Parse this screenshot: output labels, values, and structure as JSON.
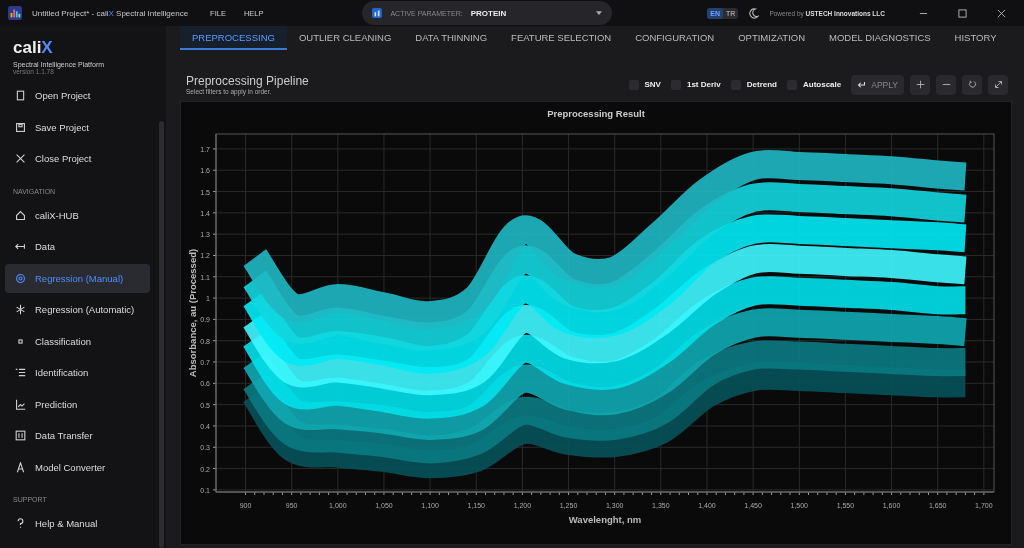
{
  "window": {
    "title": [
      {
        "text": "Untitled Project* - cali",
        "accent": false
      },
      {
        "text": "X",
        "accent": true
      },
      {
        "text": " Spectral Intelligence",
        "accent": false
      }
    ],
    "menu": [
      "FILE",
      "HELP"
    ],
    "active_parameter": {
      "label": "ACTIVE PARAMETER:",
      "value": "PROTEIN"
    },
    "languages": [
      {
        "label": "EN",
        "selected": true
      },
      {
        "label": "TR",
        "selected": false
      }
    ],
    "powered_by": {
      "prefix": "Powered by",
      "company": "USTECH Innovations LLC"
    }
  },
  "sidebar": {
    "logo": [
      {
        "text": "cali",
        "accent": false
      },
      {
        "text": "X",
        "accent": true
      }
    ],
    "tagline": "Spectral Intelligence Platform",
    "version": "version 1.1.78",
    "project_items": [
      {
        "label": "Open Project",
        "selected": false
      },
      {
        "label": "Save Project",
        "selected": false
      },
      {
        "label": "Close Project",
        "selected": false
      }
    ],
    "navigation": {
      "heading": "NAVIGATION",
      "items": [
        {
          "label": "caliX-HUB",
          "selected": false
        },
        {
          "label": "Data",
          "selected": false
        },
        {
          "label": "Regression (Manual)",
          "selected": true
        },
        {
          "label": "Regression (Automatic)",
          "selected": false
        },
        {
          "label": "Classification",
          "selected": false
        },
        {
          "label": "Identification",
          "selected": false
        },
        {
          "label": "Prediction",
          "selected": false
        },
        {
          "label": "Data Transfer",
          "selected": false
        },
        {
          "label": "Model Converter",
          "selected": false
        }
      ]
    },
    "support": {
      "heading": "SUPPORT",
      "items": [
        {
          "label": "Help & Manual",
          "selected": false
        }
      ]
    }
  },
  "tabs": [
    {
      "label": "PREPROCESSING",
      "selected": true
    },
    {
      "label": "OUTLIER CLEANING",
      "selected": false
    },
    {
      "label": "DATA THINNING",
      "selected": false
    },
    {
      "label": "FEATURE SELECTION",
      "selected": false
    },
    {
      "label": "CONFIGURATION",
      "selected": false
    },
    {
      "label": "OPTIMIZATION",
      "selected": false
    },
    {
      "label": "MODEL DIAGNOSTICS",
      "selected": false
    },
    {
      "label": "HISTORY",
      "selected": false
    }
  ],
  "pipeline": {
    "title": "Preprocessing Pipeline",
    "subtitle": "Select filters to apply in order.",
    "filters": [
      {
        "label": "SNV",
        "checked": false
      },
      {
        "label": "1st Deriv",
        "checked": false
      },
      {
        "label": "Detrend",
        "checked": false
      },
      {
        "label": "Autoscale",
        "checked": false
      }
    ],
    "apply_label": "APPLY",
    "apply_disabled": true
  },
  "chart": {
    "chart_data": {
      "type": "line",
      "title": "Preprocessing Result",
      "xlabel": "Wavelenght, nm",
      "ylabel": "Absorbance, au (Processed)",
      "x": [
        910,
        950,
        1000,
        1050,
        1100,
        1150,
        1200,
        1250,
        1300,
        1350,
        1400,
        1450,
        1500,
        1550,
        1600,
        1650,
        1680
      ],
      "series": [
        {
          "color": "#07525a",
          "values": [
            0.55,
            0.3,
            0.27,
            0.25,
            0.22,
            0.25,
            0.38,
            0.33,
            0.32,
            0.38,
            0.55,
            0.63,
            0.63,
            0.62,
            0.61,
            0.6,
            0.6
          ]
        },
        {
          "color": "#0a7a82",
          "values": [
            0.61,
            0.37,
            0.34,
            0.32,
            0.29,
            0.33,
            0.47,
            0.41,
            0.4,
            0.47,
            0.65,
            0.73,
            0.73,
            0.72,
            0.71,
            0.7,
            0.7
          ]
        },
        {
          "color": "#0fa9b3",
          "values": [
            0.71,
            0.47,
            0.45,
            0.43,
            0.4,
            0.44,
            0.62,
            0.54,
            0.52,
            0.61,
            0.79,
            0.88,
            0.88,
            0.87,
            0.86,
            0.85,
            0.84
          ]
        },
        {
          "color": "#00e0ea",
          "values": [
            0.81,
            0.56,
            0.56,
            0.53,
            0.5,
            0.55,
            0.76,
            0.66,
            0.64,
            0.75,
            0.93,
            1.03,
            1.03,
            1.02,
            1.01,
            0.99,
            0.99
          ]
        },
        {
          "color": "#3ff7ff",
          "values": [
            0.9,
            0.66,
            0.67,
            0.64,
            0.61,
            0.66,
            0.9,
            0.78,
            0.77,
            0.89,
            1.07,
            1.18,
            1.18,
            1.17,
            1.16,
            1.14,
            1.13
          ]
        },
        {
          "color": "#00eaf5",
          "values": [
            1.0,
            0.76,
            0.78,
            0.75,
            0.71,
            0.78,
            1.04,
            0.9,
            0.89,
            1.02,
            1.22,
            1.32,
            1.32,
            1.31,
            1.3,
            1.29,
            1.28
          ]
        },
        {
          "color": "#12d6e0",
          "values": [
            1.09,
            0.86,
            0.89,
            0.85,
            0.82,
            0.89,
            1.18,
            1.03,
            1.01,
            1.16,
            1.36,
            1.47,
            1.47,
            1.46,
            1.45,
            1.43,
            1.42
          ]
        },
        {
          "color": "#1fb8c4",
          "values": [
            1.19,
            0.96,
            1.0,
            0.96,
            0.92,
            1.0,
            1.32,
            1.15,
            1.13,
            1.3,
            1.5,
            1.62,
            1.62,
            1.61,
            1.6,
            1.58,
            1.57
          ]
        }
      ],
      "grid": true,
      "xlim": [
        868,
        1711
      ],
      "ylim": [
        0.09,
        1.77
      ],
      "xticks": [
        {
          "value": 900,
          "label": "900"
        },
        {
          "value": 950,
          "label": "950"
        },
        {
          "value": 1000,
          "label": "1,000"
        },
        {
          "value": 1050,
          "label": "1,050"
        },
        {
          "value": 1100,
          "label": "1,100"
        },
        {
          "value": 1150,
          "label": "1,150"
        },
        {
          "value": 1200,
          "label": "1,200"
        },
        {
          "value": 1250,
          "label": "1,250"
        },
        {
          "value": 1300,
          "label": "1,300"
        },
        {
          "value": 1350,
          "label": "1,350"
        },
        {
          "value": 1400,
          "label": "1,400"
        },
        {
          "value": 1450,
          "label": "1,450"
        },
        {
          "value": 1500,
          "label": "1,500"
        },
        {
          "value": 1550,
          "label": "1,550"
        },
        {
          "value": 1600,
          "label": "1,600"
        },
        {
          "value": 1650,
          "label": "1,650"
        },
        {
          "value": 1700,
          "label": "1,700"
        }
      ],
      "yticks": [
        {
          "value": 0.1,
          "label": "0.1"
        },
        {
          "value": 0.2,
          "label": "0.2"
        },
        {
          "value": 0.3,
          "label": "0.3"
        },
        {
          "value": 0.4,
          "label": "0.4"
        },
        {
          "value": 0.5,
          "label": "0.5"
        },
        {
          "value": 0.6,
          "label": "0.6"
        },
        {
          "value": 0.7,
          "label": "0.7"
        },
        {
          "value": 0.8,
          "label": "0.8"
        },
        {
          "value": 0.9,
          "label": "0.9"
        },
        {
          "value": 1,
          "label": "1"
        },
        {
          "value": 1.1,
          "label": "1.1"
        },
        {
          "value": 1.2,
          "label": "1.2"
        },
        {
          "value": 1.3,
          "label": "1.3"
        },
        {
          "value": 1.4,
          "label": "1.4"
        },
        {
          "value": 1.5,
          "label": "1.5"
        },
        {
          "value": 1.6,
          "label": "1.6"
        },
        {
          "value": 1.7,
          "label": "1.7"
        }
      ]
    }
  }
}
